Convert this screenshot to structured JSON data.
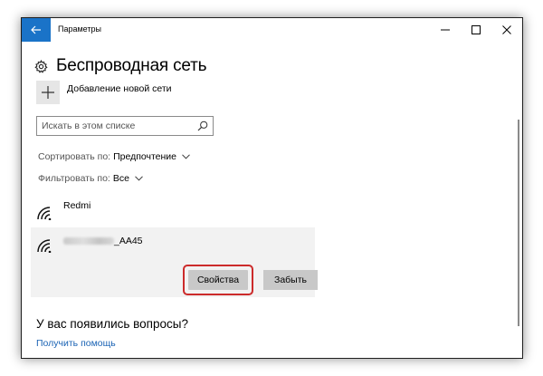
{
  "window": {
    "title": "Параметры",
    "accent": "#1a73c8"
  },
  "page": {
    "title": "Беспроводная сеть",
    "add_network_label": "Добавление новой сети"
  },
  "search": {
    "placeholder": "Искать в этом списке"
  },
  "sort": {
    "label": "Сортировать по:",
    "value": "Предпочтение"
  },
  "filter": {
    "label": "Фильтровать по:",
    "value": "Все"
  },
  "networks": [
    {
      "name": "Redmi",
      "icon": "wifi-icon"
    },
    {
      "name_visible_suffix": "_AA45",
      "icon": "wifi-icon",
      "selected": true
    }
  ],
  "buttons": {
    "properties": "Свойства",
    "forget": "Забыть"
  },
  "help": {
    "question": "У вас появились вопросы?",
    "link": "Получить помощь"
  },
  "colors": {
    "highlight_ring": "#cc2b2b",
    "link": "#1a63b4",
    "selected_bg": "#f2f2f2"
  }
}
